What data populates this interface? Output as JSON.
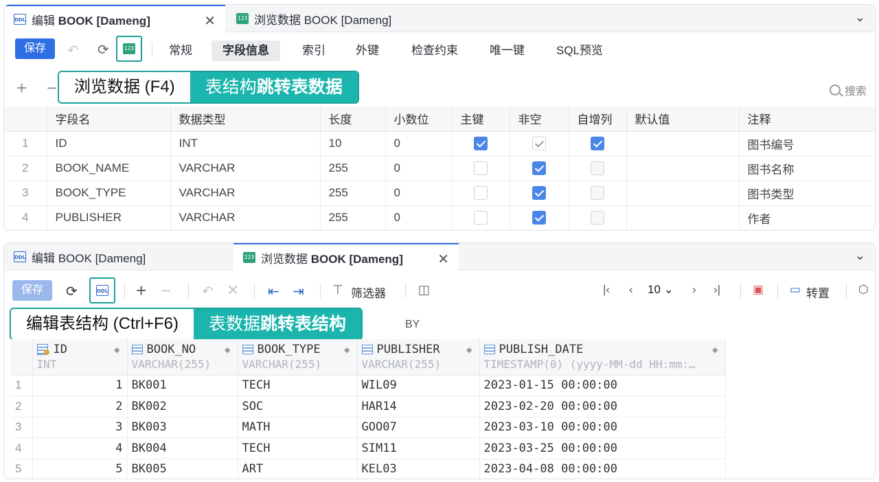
{
  "top_panel": {
    "tabs": [
      {
        "label_prefix": "编辑 ",
        "label_bold": "BOOK [Dameng]",
        "icon": "ddl-icon",
        "active": true
      },
      {
        "label": "浏览数据 BOOK [Dameng]",
        "icon": "data-123-icon",
        "active": false
      }
    ],
    "save_label": "保存",
    "subtabs": [
      "常规",
      "字段信息",
      "索引",
      "外键",
      "检查约束",
      "唯一键",
      "SQL预览"
    ],
    "active_subtab": "字段信息",
    "callout_left": "浏览数据 (F4)",
    "callout_right_plain": "表结构",
    "callout_right_bold": "跳转表数据",
    "search_label": "搜索",
    "columns": [
      "",
      "字段名",
      "数据类型",
      "长度",
      "小数位",
      "主键",
      "非空",
      "自增列",
      "默认值",
      "注释"
    ],
    "rows": [
      {
        "n": "1",
        "name": "ID",
        "type": "INT",
        "len": "10",
        "scale": "0",
        "pk": "on",
        "notnull": "grey",
        "auto": "on",
        "default": "",
        "comment": "图书编号"
      },
      {
        "n": "2",
        "name": "BOOK_NAME",
        "type": "VARCHAR",
        "len": "255",
        "scale": "0",
        "pk": "off",
        "notnull": "on",
        "auto": "dis",
        "default": "",
        "comment": "图书名称"
      },
      {
        "n": "3",
        "name": "BOOK_TYPE",
        "type": "VARCHAR",
        "len": "255",
        "scale": "0",
        "pk": "off",
        "notnull": "on",
        "auto": "dis",
        "default": "",
        "comment": "图书类型"
      },
      {
        "n": "4",
        "name": "PUBLISHER",
        "type": "VARCHAR",
        "len": "255",
        "scale": "0",
        "pk": "off",
        "notnull": "on",
        "auto": "dis",
        "default": "",
        "comment": "作者"
      }
    ]
  },
  "bottom_panel": {
    "tabs": [
      {
        "label": "编辑 BOOK [Dameng]",
        "icon": "ddl-icon",
        "active": false
      },
      {
        "label_prefix": "浏览数据 ",
        "label_bold": "BOOK [Dameng]",
        "icon": "data-123-icon",
        "active": true
      }
    ],
    "save_label": "保存",
    "filter_label": "筛选器",
    "page_size": "10",
    "pivot_label": "转置",
    "callout_left": "编辑表结构 (Ctrl+F6)",
    "callout_right_plain": "表数据",
    "callout_right_bold": "跳转表结构",
    "orderby_suffix": "BY",
    "columns": [
      {
        "name": "ID",
        "type": "INT",
        "icon": "key-column-icon"
      },
      {
        "name": "BOOK_NO",
        "type": "VARCHAR(255)",
        "icon": "column-icon"
      },
      {
        "name": "BOOK_TYPE",
        "type": "VARCHAR(255)",
        "icon": "column-icon"
      },
      {
        "name": "PUBLISHER",
        "type": "VARCHAR(255)",
        "icon": "column-icon"
      },
      {
        "name": "PUBLISH_DATE",
        "type": "TIMESTAMP(0) (yyyy-MM-dd HH:mm:…",
        "icon": "column-icon"
      }
    ],
    "rows": [
      {
        "n": "1",
        "id": "1",
        "no": "BK001",
        "type": "TECH",
        "pub": "WIL09",
        "date": "2023-01-15 00:00:00"
      },
      {
        "n": "2",
        "id": "2",
        "no": "BK002",
        "type": "SOC",
        "pub": "HAR14",
        "date": "2023-02-20 00:00:00"
      },
      {
        "n": "3",
        "id": "3",
        "no": "BK003",
        "type": "MATH",
        "pub": "GOO07",
        "date": "2023-03-10 00:00:00"
      },
      {
        "n": "4",
        "id": "4",
        "no": "BK004",
        "type": "TECH",
        "pub": "SIM11",
        "date": "2023-03-25 00:00:00"
      },
      {
        "n": "5",
        "id": "5",
        "no": "BK005",
        "type": "ART",
        "pub": "KEL03",
        "date": "2023-04-08 00:00:00"
      }
    ]
  },
  "colors": {
    "accent": "#2f6fe4",
    "callout_teal": "#1bb5ad",
    "checkbox_on": "#4a86e8"
  }
}
